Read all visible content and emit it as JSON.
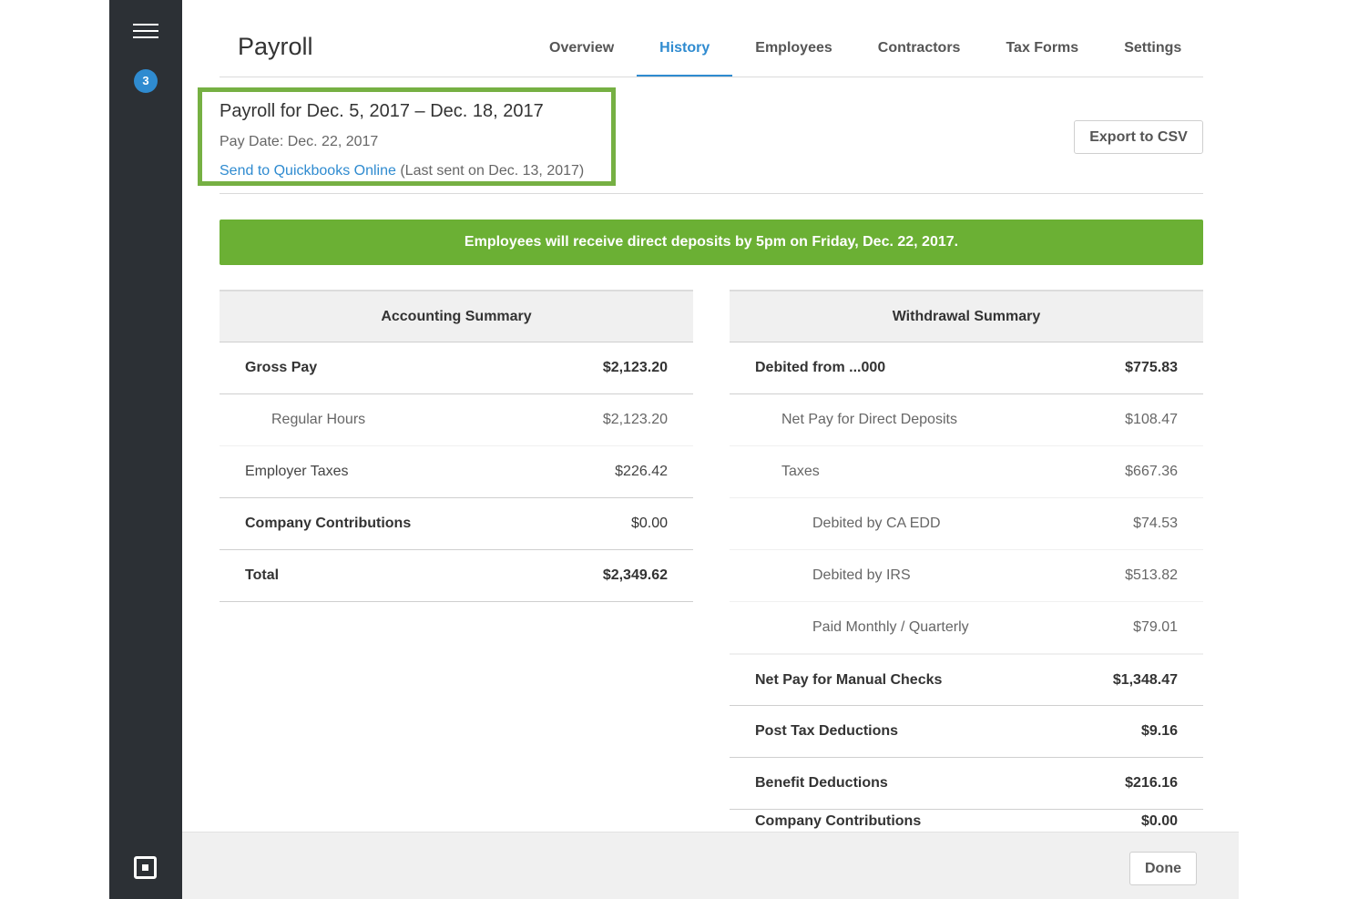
{
  "sidebar": {
    "menu_icon": "hamburger-icon",
    "badge_count": "3",
    "logo_icon": "square-logo-icon"
  },
  "header": {
    "title": "Payroll",
    "tabs": [
      {
        "label": "Overview",
        "active": false
      },
      {
        "label": "History",
        "active": true
      },
      {
        "label": "Employees",
        "active": false
      },
      {
        "label": "Contractors",
        "active": false
      },
      {
        "label": "Tax Forms",
        "active": false
      },
      {
        "label": "Settings",
        "active": false
      }
    ]
  },
  "payroll": {
    "period_title": "Payroll for Dec. 5, 2017 – Dec. 18, 2017",
    "pay_date": "Pay Date: Dec. 22, 2017",
    "qb_link": "Send to Quickbooks Online",
    "qb_last_sent": "(Last sent on Dec. 13, 2017)",
    "export_label": "Export to CSV"
  },
  "banner": {
    "text": "Employees will receive direct deposits by 5pm on Friday, Dec. 22, 2017."
  },
  "accounting": {
    "heading": "Accounting Summary",
    "rows": [
      {
        "label": "Gross Pay",
        "value": "$2,123.20"
      },
      {
        "label": "Regular Hours",
        "value": "$2,123.20"
      },
      {
        "label": "Employer Taxes",
        "value": "$226.42"
      },
      {
        "label": "Company Contributions",
        "value": "$0.00"
      },
      {
        "label": "Total",
        "value": "$2,349.62"
      }
    ]
  },
  "withdrawal": {
    "heading": "Withdrawal Summary",
    "rows": [
      {
        "label": "Debited from ...000",
        "value": "$775.83"
      },
      {
        "label": "Net Pay for Direct Deposits",
        "value": "$108.47"
      },
      {
        "label": "Taxes",
        "value": "$667.36"
      },
      {
        "label": "Debited by CA EDD",
        "value": "$74.53"
      },
      {
        "label": "Debited by IRS",
        "value": "$513.82"
      },
      {
        "label": "Paid Monthly / Quarterly",
        "value": "$79.01"
      },
      {
        "label": "Net Pay for Manual Checks",
        "value": "$1,348.47"
      },
      {
        "label": "Post Tax Deductions",
        "value": "$9.16"
      },
      {
        "label": "Benefit Deductions",
        "value": "$216.16"
      },
      {
        "label": "Company Contributions",
        "value": "$0.00"
      }
    ]
  },
  "footer": {
    "done_label": "Done"
  },
  "colors": {
    "sidebar_bg": "#2c3035",
    "accent_blue": "#2f8bd0",
    "banner_green": "#6bb034",
    "highlight_green": "#76b043"
  }
}
